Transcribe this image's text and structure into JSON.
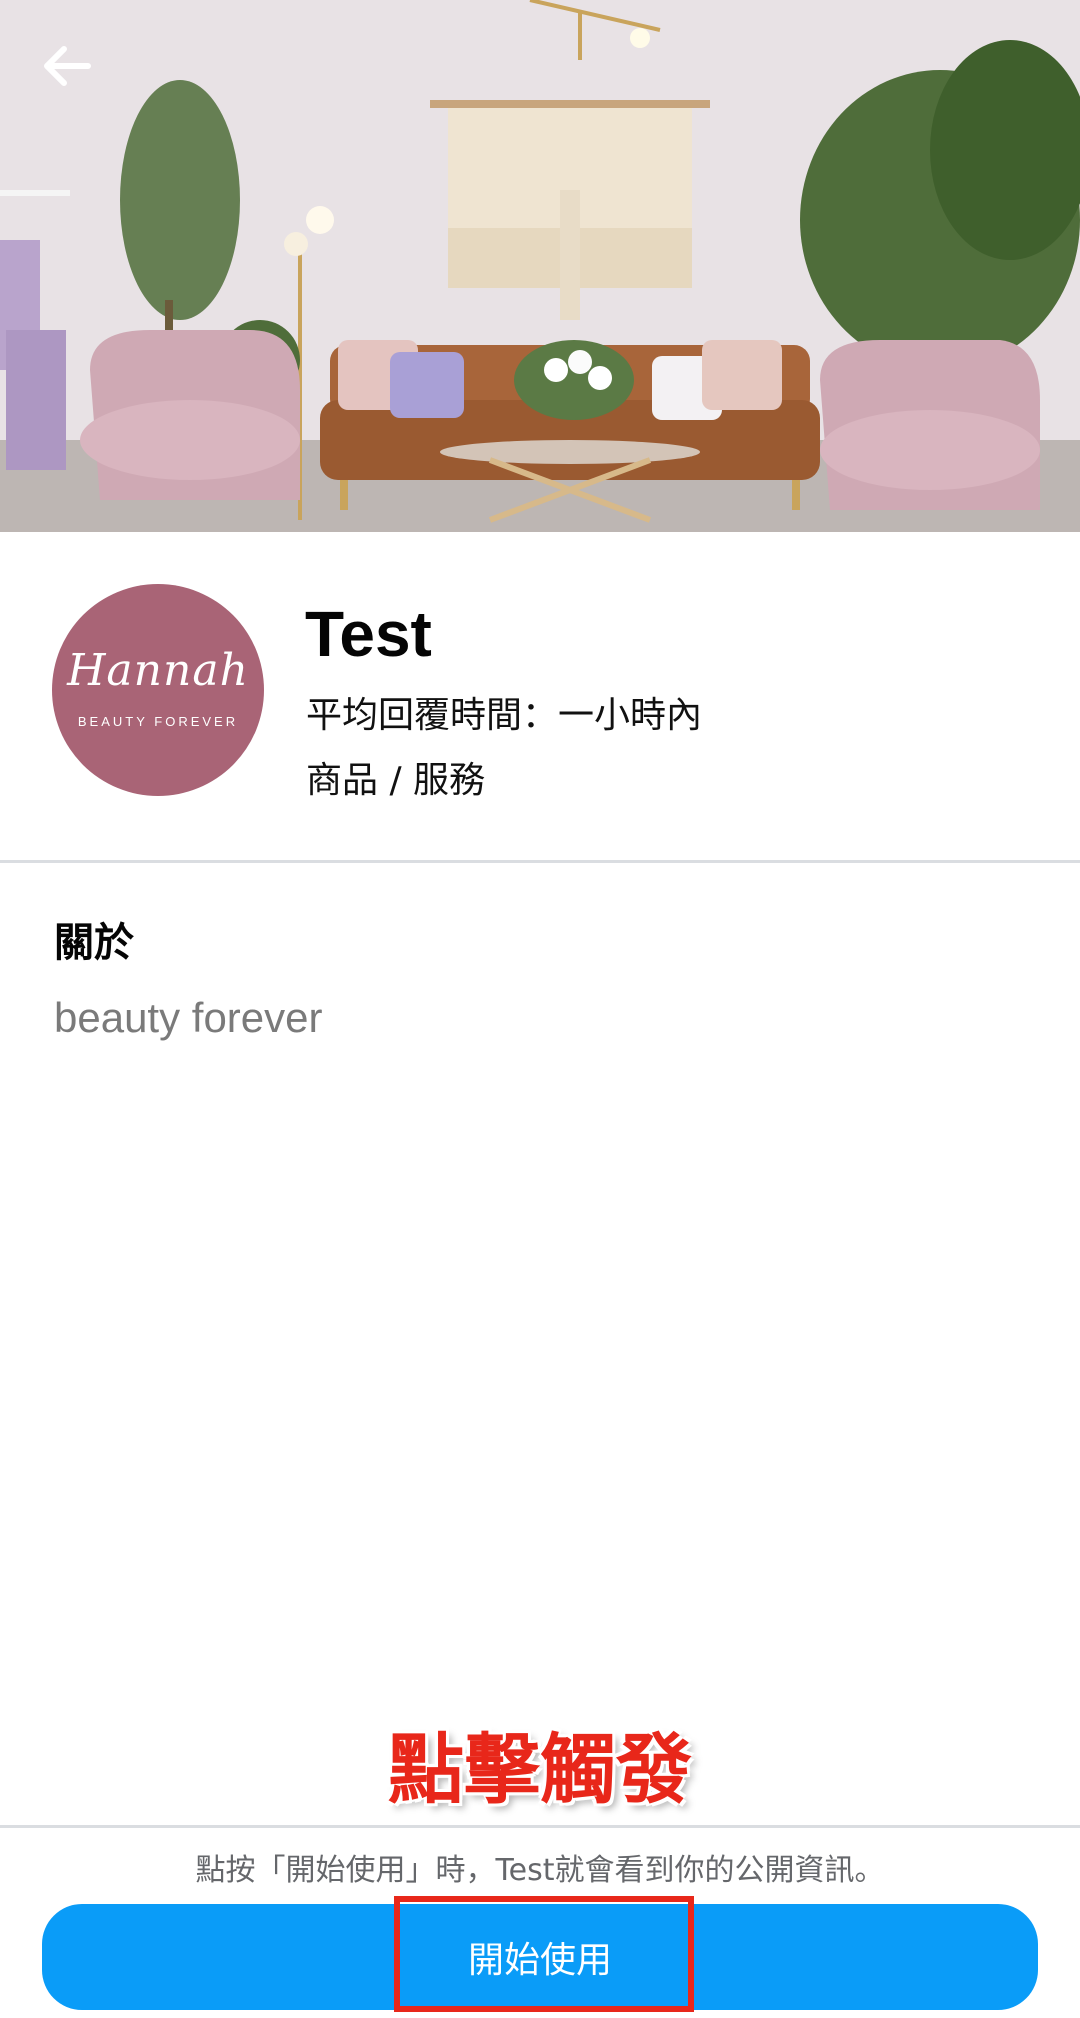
{
  "header": {
    "back_icon": "arrow-left-icon",
    "cover_image": "living-room-photo"
  },
  "profile": {
    "avatar_script": "Hannah",
    "avatar_tagline": "BEAUTY FOREVER",
    "name": "Test",
    "reply_time": "平均回覆時間：一小時內",
    "category": "商品 / 服務"
  },
  "about": {
    "title": "關於",
    "text": "beauty forever"
  },
  "annotation": {
    "text": "點擊觸發",
    "color": "#e8271a"
  },
  "footer": {
    "disclaimer": "點按「開始使用」時，Test就會看到你的公開資訊。",
    "start_label": "開始使用",
    "button_color": "#0a9cf8"
  }
}
